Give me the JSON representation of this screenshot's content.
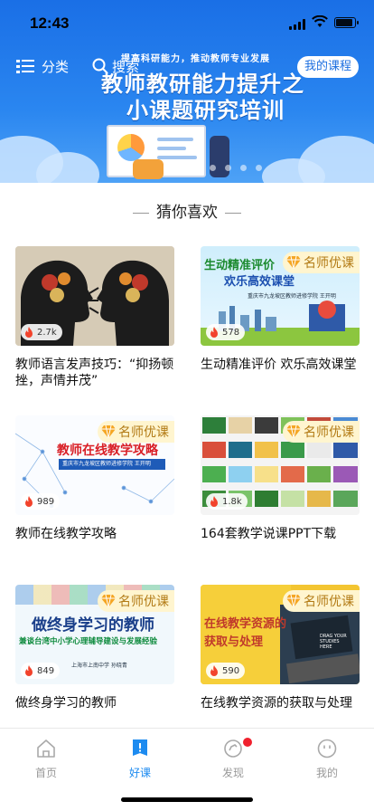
{
  "status_bar": {
    "time": "12:43"
  },
  "header": {
    "category_label": "分类",
    "search_label": "搜索",
    "my_courses_label": "我的课程"
  },
  "banner": {
    "subtitle": "提高科研能力，推动教师专业发展",
    "title_line1": "教师教研能力提升之",
    "title_line2": "小课题研究培训",
    "page_count": 6,
    "active_page": 1
  },
  "section": {
    "title": "猜你喜欢"
  },
  "courses": [
    {
      "title": "教师语言发声技巧：“抑扬顿挫，声情并茂”",
      "views": "2.7k",
      "badge": ""
    },
    {
      "title": "生动精准评价 欢乐高效课堂",
      "views": "578",
      "badge": "名师优课",
      "thumb_title": "生动精准评价",
      "thumb_title2": "欢乐高效课堂",
      "thumb_caption": "重庆市九龙坡区教师进修学院 王开明"
    },
    {
      "title": "教师在线教学攻略",
      "views": "989",
      "badge": "名师优课",
      "thumb_title": "教师在线教学攻略",
      "thumb_caption": "重庆市九龙坡区教师进修学院 王开明"
    },
    {
      "title": "164套教学说课PPT下载",
      "views": "1.8k",
      "badge": "名师优课"
    },
    {
      "title": "做终身学习的教师",
      "views": "849",
      "badge": "名师优课",
      "thumb_title": "做终身学习的教师",
      "thumb_title2": "兼谈台湾中小学心理辅导建设与发展经验",
      "thumb_caption": "上海市上南中学 孙晓青"
    },
    {
      "title": "在线教学资源的获取与处理",
      "views": "590",
      "badge": "名师优课",
      "thumb_title": "在线教学资源的",
      "thumb_title2": "获取与处理",
      "thumb_caption": "DRAG YOUR STUDIES HERE"
    }
  ],
  "tabbar": {
    "tabs": [
      {
        "label": "首页"
      },
      {
        "label": "好课"
      },
      {
        "label": "发现"
      },
      {
        "label": "我的"
      }
    ],
    "active_tab": "好课"
  },
  "colors": {
    "accent": "#1d8bf0",
    "banner": "#1a6fe6",
    "notification": "#f0212e",
    "badge_bg": "#fff5cf"
  }
}
